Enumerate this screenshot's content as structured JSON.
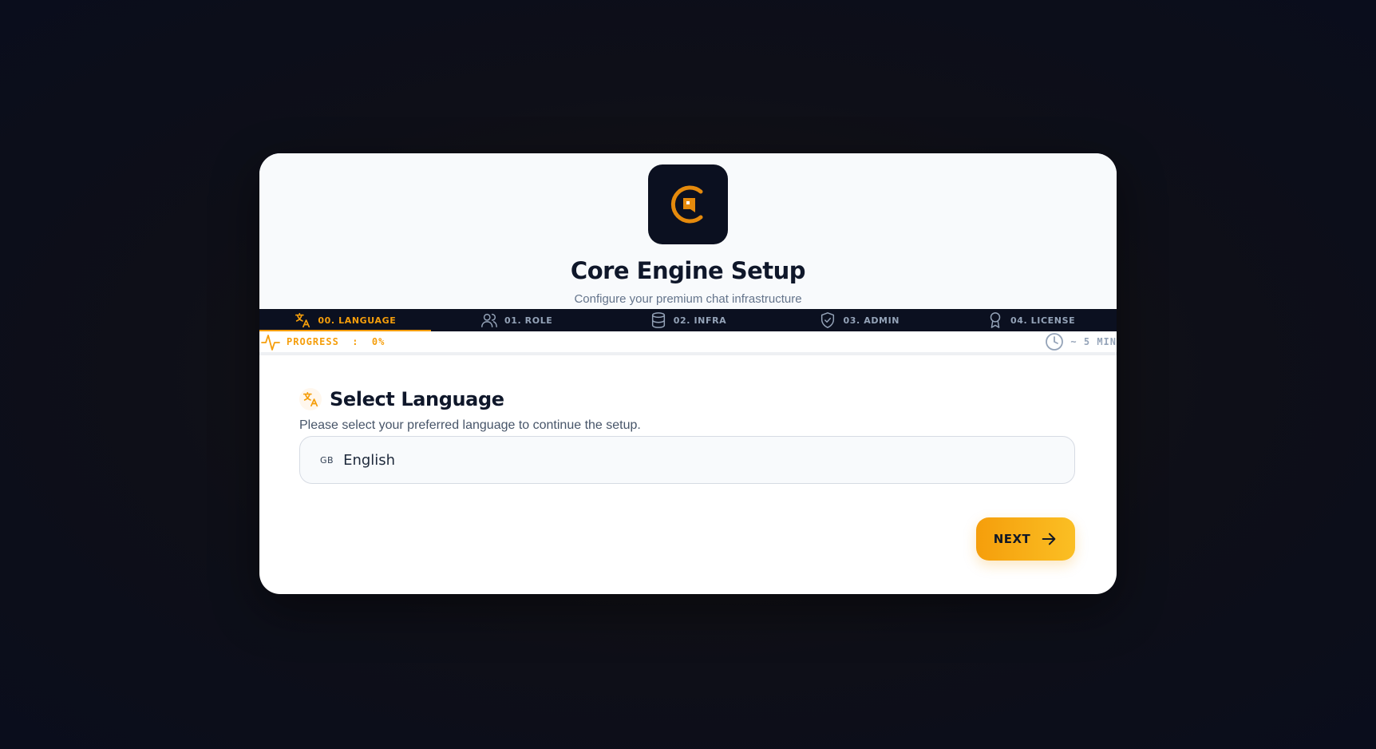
{
  "app": {
    "title": "Core Engine Setup",
    "subtitle": "Configure your premium chat infrastructure"
  },
  "steps": [
    {
      "label": "00. LANGUAGE",
      "icon": "translate-icon",
      "active": true
    },
    {
      "label": "01. ROLE",
      "icon": "users-icon",
      "active": false
    },
    {
      "label": "02. INFRA",
      "icon": "database-icon",
      "active": false
    },
    {
      "label": "03. ADMIN",
      "icon": "shield-check-icon",
      "active": false
    },
    {
      "label": "04. LICENSE",
      "icon": "award-icon",
      "active": false
    }
  ],
  "progress": {
    "label": "PROGRESS  :  0%",
    "value": 0,
    "eta": "~ 5 MIN"
  },
  "section": {
    "title": "Select Language",
    "description": "Please select your preferred language to continue the setup."
  },
  "language_select": {
    "flag_code": "GB",
    "value": "English"
  },
  "actions": {
    "next_label": "NEXT"
  },
  "colors": {
    "accent": "#f59e0b",
    "dark": "#0b1020",
    "muted": "#94a3b8"
  }
}
